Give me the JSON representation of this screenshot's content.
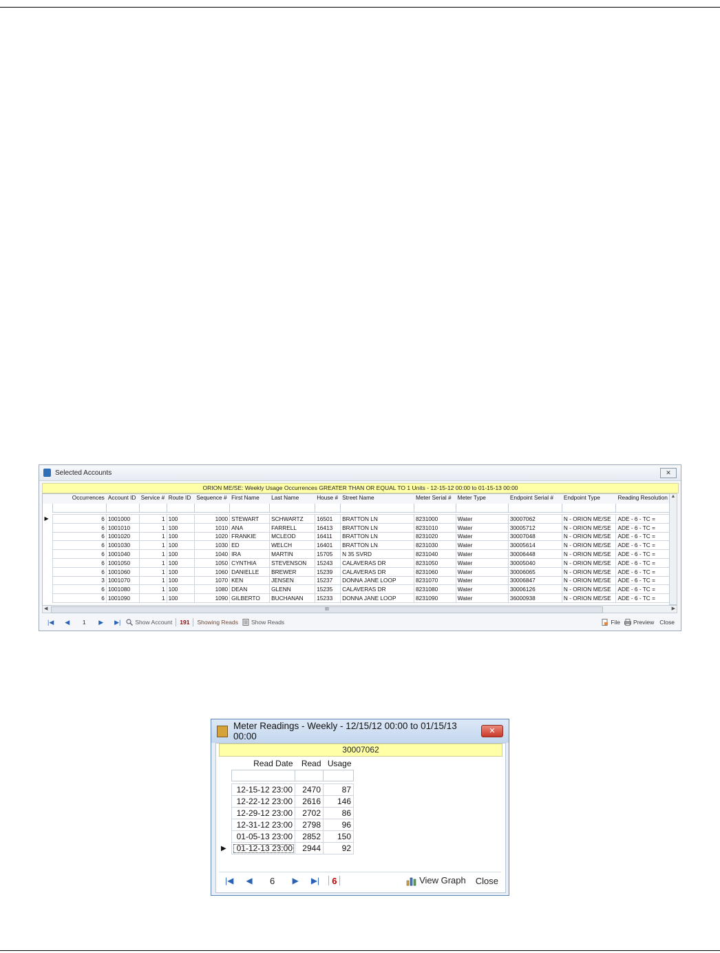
{
  "accounts_window": {
    "title": "Selected Accounts",
    "close_label": "✕",
    "banner": "ORION ME/SE: Weekly Usage Occurrences GREATER THAN OR EQUAL TO 1 Units - 12-15-12 00:00 to 01-15-13 00:00",
    "columns": [
      "Occurrences",
      "Account ID",
      "Service #",
      "Route ID",
      "Sequence #",
      "First Name",
      "Last Name",
      "House #",
      "Street Name",
      "Meter Serial #",
      "Meter Type",
      "Endpoint Serial #",
      "Endpoint Type",
      "Reading Resolution"
    ],
    "rows": [
      [
        "6",
        "1001000",
        "1",
        "100",
        "1000",
        "STEWART",
        "SCHWARTZ",
        "16501",
        "BRATTON LN",
        "8231000",
        "Water",
        "30007062",
        "N - ORION ME/SE",
        "ADE - 6 - TC ="
      ],
      [
        "6",
        "1001010",
        "1",
        "100",
        "1010",
        "ANA",
        "FARRELL",
        "16413",
        "BRATTON LN",
        "8231010",
        "Water",
        "30005712",
        "N - ORION ME/SE",
        "ADE - 6 - TC ="
      ],
      [
        "6",
        "1001020",
        "1",
        "100",
        "1020",
        "FRANKIE",
        "MCLEOD",
        "16411",
        "BRATTON LN",
        "8231020",
        "Water",
        "30007048",
        "N - ORION ME/SE",
        "ADE - 6 - TC ="
      ],
      [
        "6",
        "1001030",
        "1",
        "100",
        "1030",
        "ED",
        "WELCH",
        "16401",
        "BRATTON LN",
        "8231030",
        "Water",
        "30005614",
        "N - ORION ME/SE",
        "ADE - 6 - TC ="
      ],
      [
        "6",
        "1001040",
        "1",
        "100",
        "1040",
        "IRA",
        "MARTIN",
        "15705",
        "N 35 SVRD",
        "8231040",
        "Water",
        "30006448",
        "N - ORION ME/SE",
        "ADE - 6 - TC ="
      ],
      [
        "6",
        "1001050",
        "1",
        "100",
        "1050",
        "CYNTHIA",
        "STEVENSON",
        "15243",
        "CALAVERAS DR",
        "8231050",
        "Water",
        "30005040",
        "N - ORION ME/SE",
        "ADE - 6 - TC ="
      ],
      [
        "6",
        "1001060",
        "1",
        "100",
        "1060",
        "DANIELLE",
        "BREWER",
        "15239",
        "CALAVERAS DR",
        "8231060",
        "Water",
        "30006065",
        "N - ORION ME/SE",
        "ADE - 6 - TC ="
      ],
      [
        "3",
        "1001070",
        "1",
        "100",
        "1070",
        "KEN",
        "JENSEN",
        "15237",
        "DONNA JANE LOOP",
        "8231070",
        "Water",
        "30006847",
        "N - ORION ME/SE",
        "ADE - 6 - TC ="
      ],
      [
        "6",
        "1001080",
        "1",
        "100",
        "1080",
        "DEAN",
        "GLENN",
        "15235",
        "CALAVERAS DR",
        "8231080",
        "Water",
        "30006126",
        "N - ORION ME/SE",
        "ADE - 6 - TC ="
      ],
      [
        "6",
        "1001090",
        "1",
        "100",
        "1090",
        "GILBERTO",
        "BUCHANAN",
        "15233",
        "DONNA JANE LOOP",
        "8231090",
        "Water",
        "36000938",
        "N - ORION ME/SE",
        "ADE - 6 - TC ="
      ]
    ],
    "scroll_label": "III",
    "nav": {
      "page": "1",
      "show_account": "Show Account",
      "count": "191",
      "showing_reads": "Showing Reads",
      "show_reads": "Show Reads",
      "file": "File",
      "preview": "Preview",
      "close": "Close"
    }
  },
  "readings_window": {
    "title": "Meter Readings - Weekly - 12/15/12 00:00 to 01/15/13 00:00",
    "close_label": "✕",
    "banner": "30007062",
    "columns": [
      "Read Date",
      "Read",
      "Usage"
    ],
    "rows": [
      [
        "12-15-12 23:00",
        "2470",
        "87"
      ],
      [
        "12-22-12 23:00",
        "2616",
        "146"
      ],
      [
        "12-29-12 23:00",
        "2702",
        "86"
      ],
      [
        "12-31-12 23:00",
        "2798",
        "96"
      ],
      [
        "01-05-13 23:00",
        "2852",
        "150"
      ],
      [
        "01-12-13 23:00",
        "2944",
        "92"
      ]
    ],
    "nav": {
      "page": "6",
      "count": "6",
      "view_graph": "View Graph",
      "close": "Close"
    }
  },
  "icons": {
    "first": "first-page-icon",
    "prev": "prev-page-icon",
    "next": "next-page-icon",
    "last": "last-page-icon",
    "search": "magnifier-icon",
    "reads": "document-icon",
    "file": "file-export-icon",
    "preview": "printer-icon",
    "graph": "bar-chart-icon"
  }
}
